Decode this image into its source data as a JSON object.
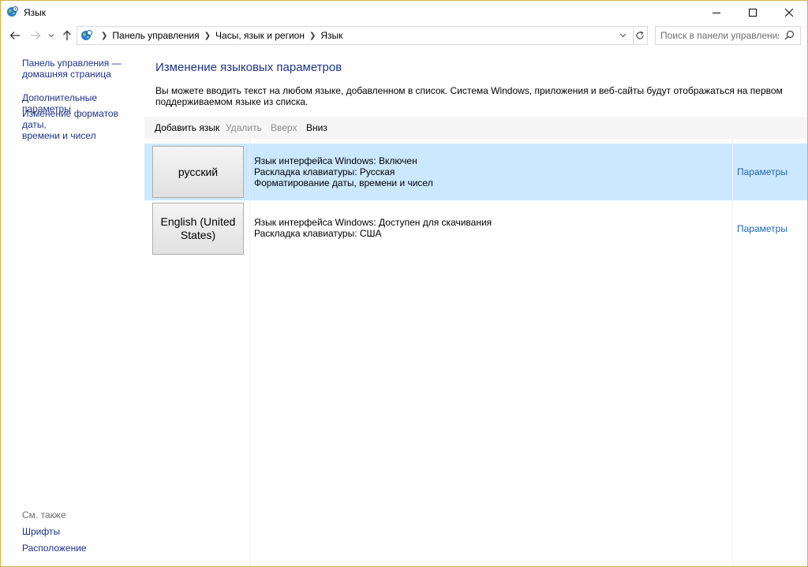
{
  "window": {
    "title": "Язык"
  },
  "address": {
    "crumbs": [
      "Панель управления",
      "Часы, язык и регион",
      "Язык"
    ]
  },
  "search": {
    "placeholder": "Поиск в панели управления"
  },
  "sidebar": {
    "home_link_line1": "Панель управления —",
    "home_link_line2": "домашняя страница",
    "advanced": "Дополнительные параметры",
    "formats_line1": "Изменение форматов даты,",
    "formats_line2": "времени и чисел",
    "see_also": "См. также",
    "fonts": "Шрифты",
    "location": "Расположение"
  },
  "main": {
    "heading": "Изменение языковых параметров",
    "description": "Вы можете вводить текст на любом языке, добавленном в список. Система Windows, приложения и веб-сайты будут отображаться на первом поддерживаемом языке из списка."
  },
  "toolbar": {
    "add": "Добавить язык",
    "remove": "Удалить",
    "up": "Вверх",
    "down": "Вниз"
  },
  "languages": [
    {
      "name": "русский",
      "line1": "Язык интерфейса Windows: Включен",
      "line2": "Раскладка клавиатуры: Русская",
      "line3": "Форматирование даты, времени и чисел",
      "options": "Параметры",
      "selected": true
    },
    {
      "name": "English (United States)",
      "line1": "Язык интерфейса Windows: Доступен для скачивания",
      "line2": "Раскладка клавиатуры: США",
      "options": "Параметры",
      "selected": false
    }
  ],
  "colors": {
    "link": "#1e3287",
    "options_link": "#1e64b4",
    "selected_row": "#cce8ff",
    "toolbar_bg": "#f5f5f5"
  },
  "icons": {
    "app": "globe-clock-icon",
    "back": "arrow-left-icon",
    "forward": "arrow-right-icon",
    "recent": "chevron-down-icon",
    "up": "arrow-up-icon",
    "refresh": "refresh-icon",
    "search": "search-icon"
  }
}
